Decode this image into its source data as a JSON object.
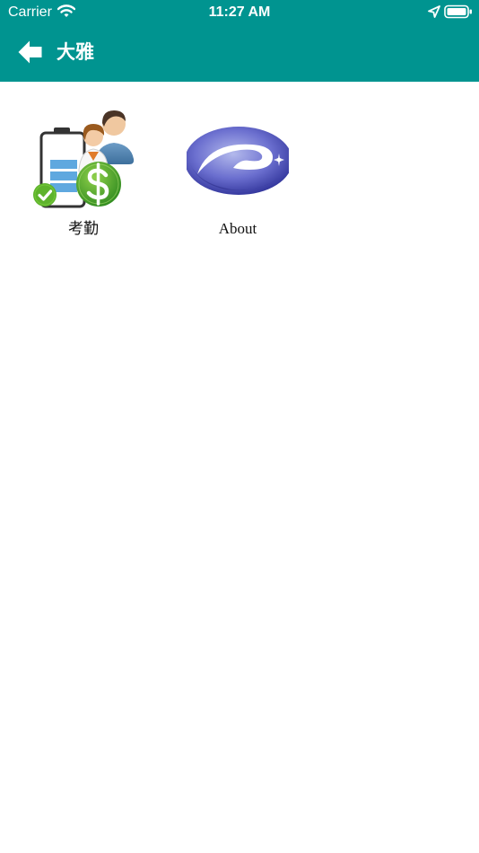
{
  "status_bar": {
    "carrier": "Carrier",
    "time": "11:27 AM",
    "icons": [
      "wifi-icon",
      "location-icon",
      "battery-icon"
    ]
  },
  "nav": {
    "title": "大雅",
    "back_icon": "back-arrow-icon"
  },
  "tiles": [
    {
      "label": "考勤",
      "icon": "attendance-payroll-icon"
    },
    {
      "label": "About",
      "icon": "company-logo-icon"
    }
  ],
  "colors": {
    "header": "#009490",
    "background": "#ffffff",
    "text": "#111111"
  }
}
